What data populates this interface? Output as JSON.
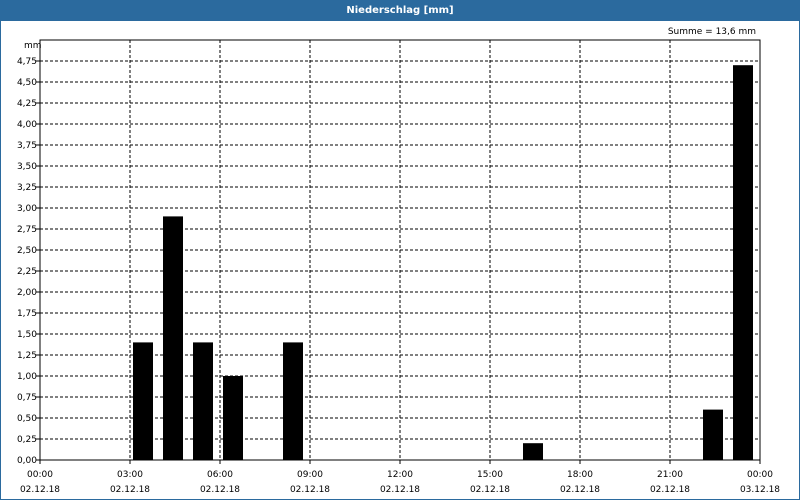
{
  "title": "Niederschlag [mm]",
  "chart_data": {
    "type": "bar",
    "title": "Niederschlag [mm]",
    "ylabel": "mm",
    "annotation": "Summe = 13,6 mm",
    "ylim": [
      0,
      5.0
    ],
    "y_ticks": [
      "0,00",
      "0,25",
      "0,50",
      "0,75",
      "1,00",
      "1,25",
      "1,50",
      "1,75",
      "2,00",
      "2,25",
      "2,50",
      "2,75",
      "3,00",
      "3,25",
      "3,50",
      "3,75",
      "4,00",
      "4,25",
      "4,50",
      "4,75"
    ],
    "x_ticks": [
      {
        "time": "00:00",
        "date": "02.12.18"
      },
      {
        "time": "03:00",
        "date": "02.12.18"
      },
      {
        "time": "06:00",
        "date": "02.12.18"
      },
      {
        "time": "09:00",
        "date": "02.12.18"
      },
      {
        "time": "12:00",
        "date": "02.12.18"
      },
      {
        "time": "15:00",
        "date": "02.12.18"
      },
      {
        "time": "18:00",
        "date": "02.12.18"
      },
      {
        "time": "21:00",
        "date": "02.12.18"
      },
      {
        "time": "00:00",
        "date": "03.12.18"
      }
    ],
    "bars": [
      {
        "time": "02.12.18 04:00",
        "value": 1.4
      },
      {
        "time": "02.12.18 05:00",
        "value": 2.9
      },
      {
        "time": "02.12.18 06:00",
        "value": 1.4
      },
      {
        "time": "02.12.18 07:00",
        "value": 1.0
      },
      {
        "time": "02.12.18 09:00",
        "value": 1.4
      },
      {
        "time": "02.12.18 17:00",
        "value": 0.2
      },
      {
        "time": "02.12.18 23:00",
        "value": 0.6
      },
      {
        "time": "03.12.18 00:00",
        "value": 4.7
      }
    ],
    "bar_color": "#000000",
    "grid": true
  }
}
